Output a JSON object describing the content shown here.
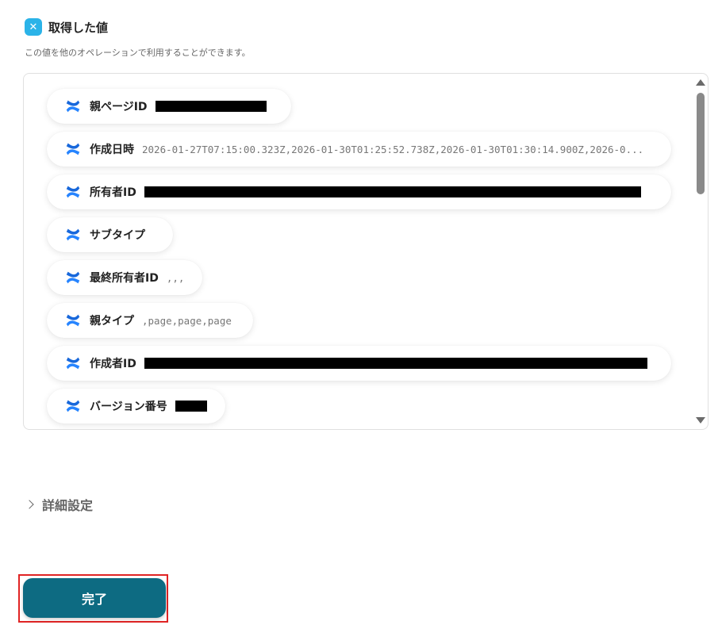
{
  "header": {
    "title": "取得した値",
    "description": "この値を他のオペレーションで利用することができます。"
  },
  "outputs": [
    {
      "label": "親ページID",
      "value": "",
      "redacted": true
    },
    {
      "label": "作成日時",
      "value": "2026-01-27T07:15:00.323Z,2026-01-30T01:25:52.738Z,2026-01-30T01:30:14.900Z,2026-0..."
    },
    {
      "label": "所有者ID",
      "value": "",
      "redacted": true
    },
    {
      "label": "サブタイプ",
      "value": ""
    },
    {
      "label": "最終所有者ID",
      "value": ",,,"
    },
    {
      "label": "親タイプ",
      "value": ",page,page,page"
    },
    {
      "label": "作成者ID",
      "value": "",
      "redacted": true
    },
    {
      "label": "バージョン番号",
      "value": "",
      "redacted": true
    }
  ],
  "details": {
    "label": "詳細設定"
  },
  "actions": {
    "done_label": "完了"
  },
  "colors": {
    "primary": "#0d6b82",
    "accent": "#2bb3e8",
    "confluence_blue": "#2684ff",
    "highlight": "#e02424"
  },
  "icons": {
    "header": "yoom-x-icon",
    "output": "confluence-icon",
    "details": "chevron-right-icon"
  }
}
